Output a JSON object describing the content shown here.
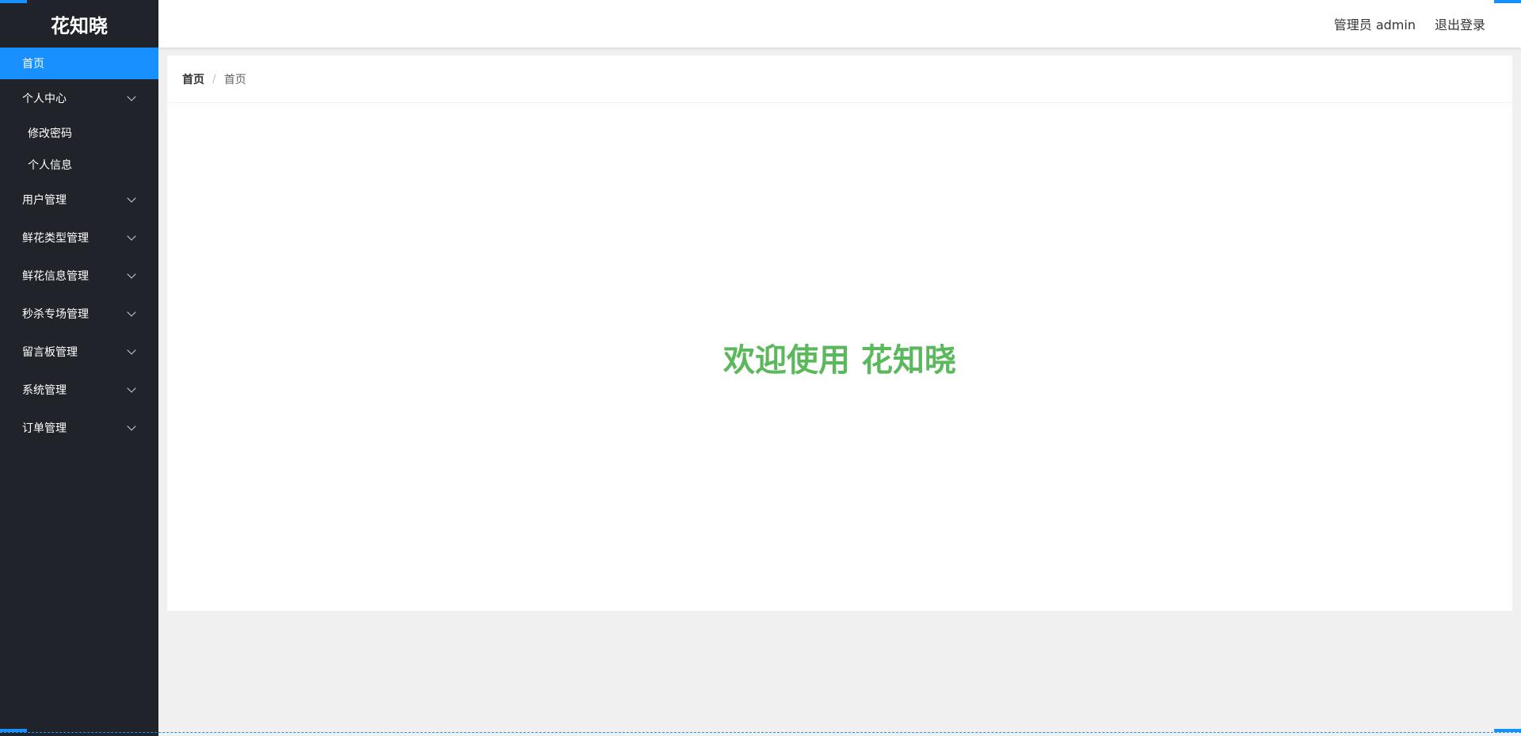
{
  "brand": {
    "name": "花知晓"
  },
  "sidebar": {
    "home": "首页",
    "groups": [
      {
        "label": "个人中心",
        "items": [
          "修改密码",
          "个人信息"
        ]
      },
      {
        "label": "用户管理"
      },
      {
        "label": "鲜花类型管理"
      },
      {
        "label": "鲜花信息管理"
      },
      {
        "label": "秒杀专场管理"
      },
      {
        "label": "留言板管理"
      },
      {
        "label": "系统管理"
      },
      {
        "label": "订单管理"
      }
    ]
  },
  "header": {
    "user": "管理员 admin",
    "logout": "退出登录"
  },
  "breadcrumb": {
    "items": [
      "首页",
      "首页"
    ],
    "separator": "/"
  },
  "main": {
    "welcome": "欢迎使用 花知晓"
  },
  "colors": {
    "accent": "#1890ff",
    "sidebar_bg": "#20232a",
    "welcome": "#5cb85c"
  }
}
